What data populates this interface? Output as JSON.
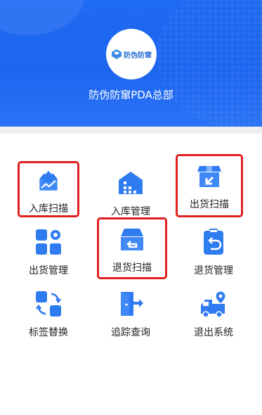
{
  "header": {
    "logo_text": "防伪防窜",
    "company_name": "防伪防窜PDA总部"
  },
  "menu": [
    {
      "label": "入库扫描",
      "icon": "inbox-scan-icon",
      "highlighted": true
    },
    {
      "label": "入库管理",
      "icon": "warehouse-building-icon",
      "highlighted": false
    },
    {
      "label": "出货扫描",
      "icon": "box-outbound-icon",
      "highlighted": true
    },
    {
      "label": "出货管理",
      "icon": "grid-settings-icon",
      "highlighted": false
    },
    {
      "label": "退货扫描",
      "icon": "box-return-icon",
      "highlighted": true
    },
    {
      "label": "退货管理",
      "icon": "clipboard-return-icon",
      "highlighted": false
    },
    {
      "label": "标签替换",
      "icon": "swap-tags-icon",
      "highlighted": false
    },
    {
      "label": "追踪查询",
      "icon": "track-exit-door-icon",
      "highlighted": false
    },
    {
      "label": "退出系统",
      "icon": "delivery-truck-location-icon",
      "highlighted": false
    }
  ],
  "colors": {
    "header_blue": "#1f6af2",
    "icon_blue": "#2f7bf0",
    "highlight_red": "#e02020"
  }
}
